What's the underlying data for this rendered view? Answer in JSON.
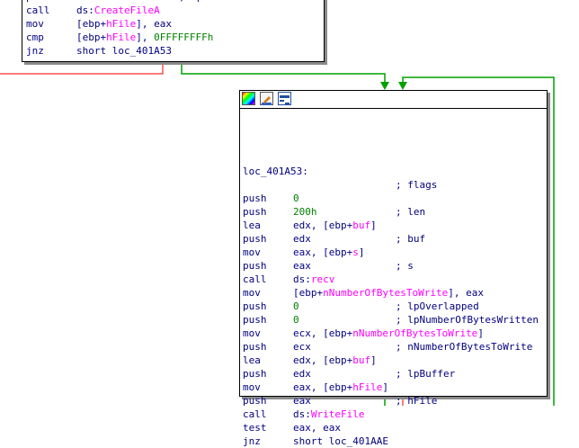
{
  "colors": {
    "red_edge": "#ff5050",
    "green_edge": "#00a000",
    "symbol": "#ff00ff",
    "number": "#008000",
    "text": "#000080"
  },
  "toolbar_icons": [
    "color-palette-icon",
    "rename-icon",
    "graph-overview-icon"
  ],
  "top_block": {
    "lines": [
      {
        "mn": "push",
        "op": [
          {
            "t": "eax",
            "c": "txt"
          }
        ],
        "cm": "; lpFileName"
      },
      {
        "mn": "call",
        "op": [
          {
            "t": "ds:",
            "c": "txt"
          },
          {
            "t": "CreateFileA",
            "c": "sym"
          }
        ],
        "cm": ""
      },
      {
        "mn": "mov",
        "op": [
          {
            "t": "[ebp+",
            "c": "txt"
          },
          {
            "t": "hFile",
            "c": "sym"
          },
          {
            "t": "], eax",
            "c": "txt"
          }
        ],
        "cm": ""
      },
      {
        "mn": "cmp",
        "op": [
          {
            "t": "[ebp+",
            "c": "txt"
          },
          {
            "t": "hFile",
            "c": "sym"
          },
          {
            "t": "], ",
            "c": "txt"
          },
          {
            "t": "0FFFFFFFFh",
            "c": "num"
          }
        ],
        "cm": ""
      },
      {
        "mn": "jnz",
        "op": [
          {
            "t": "short loc_401A53",
            "c": "txt"
          }
        ],
        "cm": ""
      }
    ]
  },
  "main_block": {
    "label": "loc_401A53:",
    "label_comment": "; flags",
    "lines": [
      {
        "mn": "push",
        "op": [
          {
            "t": "0",
            "c": "num"
          }
        ],
        "cm": ""
      },
      {
        "mn": "push",
        "op": [
          {
            "t": "200h",
            "c": "num"
          }
        ],
        "cm": "; len"
      },
      {
        "mn": "lea",
        "op": [
          {
            "t": "edx, [ebp+",
            "c": "txt"
          },
          {
            "t": "buf",
            "c": "sym"
          },
          {
            "t": "]",
            "c": "txt"
          }
        ],
        "cm": ""
      },
      {
        "mn": "push",
        "op": [
          {
            "t": "edx",
            "c": "txt"
          }
        ],
        "cm": "; buf"
      },
      {
        "mn": "mov",
        "op": [
          {
            "t": "eax, [ebp+",
            "c": "txt"
          },
          {
            "t": "s",
            "c": "sym"
          },
          {
            "t": "]",
            "c": "txt"
          }
        ],
        "cm": ""
      },
      {
        "mn": "push",
        "op": [
          {
            "t": "eax",
            "c": "txt"
          }
        ],
        "cm": "; s"
      },
      {
        "mn": "call",
        "op": [
          {
            "t": "ds:",
            "c": "txt"
          },
          {
            "t": "recv",
            "c": "sym"
          }
        ],
        "cm": ""
      },
      {
        "mn": "mov",
        "op": [
          {
            "t": "[ebp+",
            "c": "txt"
          },
          {
            "t": "nNumberOfBytesToWrite",
            "c": "sym"
          },
          {
            "t": "], eax",
            "c": "txt"
          }
        ],
        "cm": ""
      },
      {
        "mn": "push",
        "op": [
          {
            "t": "0",
            "c": "num"
          }
        ],
        "cm": "; lpOverlapped"
      },
      {
        "mn": "push",
        "op": [
          {
            "t": "0",
            "c": "num"
          }
        ],
        "cm": "; lpNumberOfBytesWritten"
      },
      {
        "mn": "mov",
        "op": [
          {
            "t": "ecx, [ebp+",
            "c": "txt"
          },
          {
            "t": "nNumberOfBytesToWrite",
            "c": "sym"
          },
          {
            "t": "]",
            "c": "txt"
          }
        ],
        "cm": ""
      },
      {
        "mn": "push",
        "op": [
          {
            "t": "ecx",
            "c": "txt"
          }
        ],
        "cm": "; nNumberOfBytesToWrite"
      },
      {
        "mn": "lea",
        "op": [
          {
            "t": "edx, [ebp+",
            "c": "txt"
          },
          {
            "t": "buf",
            "c": "sym"
          },
          {
            "t": "]",
            "c": "txt"
          }
        ],
        "cm": ""
      },
      {
        "mn": "push",
        "op": [
          {
            "t": "edx",
            "c": "txt"
          }
        ],
        "cm": "; lpBuffer"
      },
      {
        "mn": "mov",
        "op": [
          {
            "t": "eax, [ebp+",
            "c": "txt"
          },
          {
            "t": "hFile",
            "c": "sym"
          },
          {
            "t": "]",
            "c": "txt"
          }
        ],
        "cm": ""
      },
      {
        "mn": "push",
        "op": [
          {
            "t": "eax",
            "c": "txt"
          }
        ],
        "cm": "; hFile"
      },
      {
        "mn": "call",
        "op": [
          {
            "t": "ds:",
            "c": "txt"
          },
          {
            "t": "WriteFile",
            "c": "sym"
          }
        ],
        "cm": ""
      },
      {
        "mn": "test",
        "op": [
          {
            "t": "eax, eax",
            "c": "txt"
          }
        ],
        "cm": ""
      },
      {
        "mn": "jnz",
        "op": [
          {
            "t": "short loc_401AAE",
            "c": "txt"
          }
        ],
        "cm": ""
      }
    ]
  }
}
